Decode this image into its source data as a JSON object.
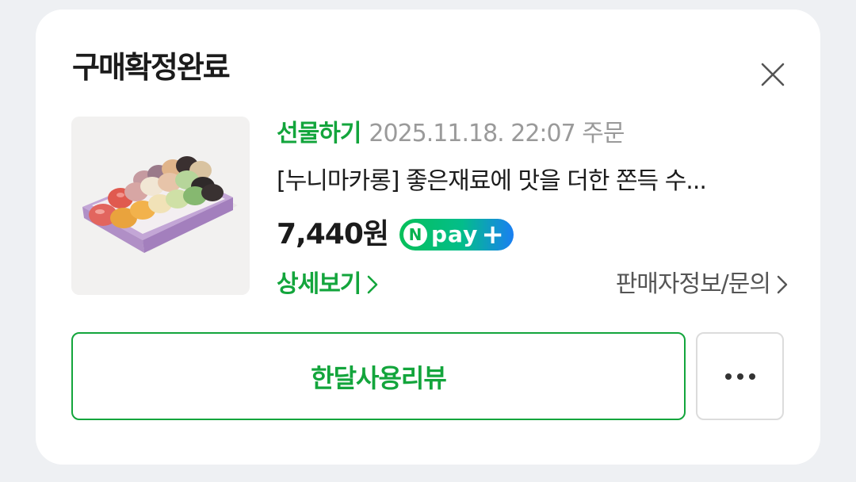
{
  "card": {
    "title": "구매확정완료",
    "close_icon": "close-icon"
  },
  "order": {
    "gift_label": "선물하기",
    "date": "2025.11.18. 22:07 주문",
    "product_name": "[누니마카롱] 좋은재료에 맛을 더한 쫀득 수...",
    "price": "7,440원",
    "npay": {
      "n": "N",
      "text": "pay",
      "plus": "+"
    },
    "thumbnail_icon": "macaron-box-image"
  },
  "links": {
    "detail": "상세보기",
    "seller": "판매자정보/문의"
  },
  "actions": {
    "review": "한달사용리뷰",
    "more_icon": "more-dots-icon"
  },
  "colors": {
    "accent_green": "#13a53c",
    "card_bg": "#ffffff",
    "page_bg": "#eef0f3"
  }
}
